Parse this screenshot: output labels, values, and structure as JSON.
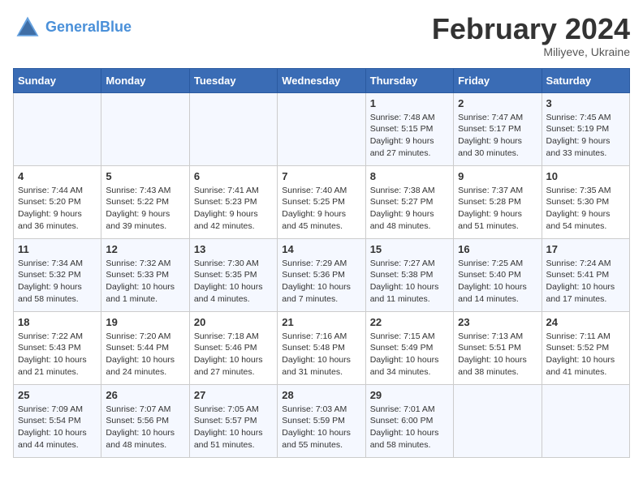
{
  "header": {
    "logo_line1": "General",
    "logo_line2": "Blue",
    "month_title": "February 2024",
    "subtitle": "Miliyeve, Ukraine"
  },
  "weekdays": [
    "Sunday",
    "Monday",
    "Tuesday",
    "Wednesday",
    "Thursday",
    "Friday",
    "Saturday"
  ],
  "weeks": [
    [
      {
        "day": "",
        "info": ""
      },
      {
        "day": "",
        "info": ""
      },
      {
        "day": "",
        "info": ""
      },
      {
        "day": "",
        "info": ""
      },
      {
        "day": "1",
        "info": "Sunrise: 7:48 AM\nSunset: 5:15 PM\nDaylight: 9 hours\nand 27 minutes."
      },
      {
        "day": "2",
        "info": "Sunrise: 7:47 AM\nSunset: 5:17 PM\nDaylight: 9 hours\nand 30 minutes."
      },
      {
        "day": "3",
        "info": "Sunrise: 7:45 AM\nSunset: 5:19 PM\nDaylight: 9 hours\nand 33 minutes."
      }
    ],
    [
      {
        "day": "4",
        "info": "Sunrise: 7:44 AM\nSunset: 5:20 PM\nDaylight: 9 hours\nand 36 minutes."
      },
      {
        "day": "5",
        "info": "Sunrise: 7:43 AM\nSunset: 5:22 PM\nDaylight: 9 hours\nand 39 minutes."
      },
      {
        "day": "6",
        "info": "Sunrise: 7:41 AM\nSunset: 5:23 PM\nDaylight: 9 hours\nand 42 minutes."
      },
      {
        "day": "7",
        "info": "Sunrise: 7:40 AM\nSunset: 5:25 PM\nDaylight: 9 hours\nand 45 minutes."
      },
      {
        "day": "8",
        "info": "Sunrise: 7:38 AM\nSunset: 5:27 PM\nDaylight: 9 hours\nand 48 minutes."
      },
      {
        "day": "9",
        "info": "Sunrise: 7:37 AM\nSunset: 5:28 PM\nDaylight: 9 hours\nand 51 minutes."
      },
      {
        "day": "10",
        "info": "Sunrise: 7:35 AM\nSunset: 5:30 PM\nDaylight: 9 hours\nand 54 minutes."
      }
    ],
    [
      {
        "day": "11",
        "info": "Sunrise: 7:34 AM\nSunset: 5:32 PM\nDaylight: 9 hours\nand 58 minutes."
      },
      {
        "day": "12",
        "info": "Sunrise: 7:32 AM\nSunset: 5:33 PM\nDaylight: 10 hours\nand 1 minute."
      },
      {
        "day": "13",
        "info": "Sunrise: 7:30 AM\nSunset: 5:35 PM\nDaylight: 10 hours\nand 4 minutes."
      },
      {
        "day": "14",
        "info": "Sunrise: 7:29 AM\nSunset: 5:36 PM\nDaylight: 10 hours\nand 7 minutes."
      },
      {
        "day": "15",
        "info": "Sunrise: 7:27 AM\nSunset: 5:38 PM\nDaylight: 10 hours\nand 11 minutes."
      },
      {
        "day": "16",
        "info": "Sunrise: 7:25 AM\nSunset: 5:40 PM\nDaylight: 10 hours\nand 14 minutes."
      },
      {
        "day": "17",
        "info": "Sunrise: 7:24 AM\nSunset: 5:41 PM\nDaylight: 10 hours\nand 17 minutes."
      }
    ],
    [
      {
        "day": "18",
        "info": "Sunrise: 7:22 AM\nSunset: 5:43 PM\nDaylight: 10 hours\nand 21 minutes."
      },
      {
        "day": "19",
        "info": "Sunrise: 7:20 AM\nSunset: 5:44 PM\nDaylight: 10 hours\nand 24 minutes."
      },
      {
        "day": "20",
        "info": "Sunrise: 7:18 AM\nSunset: 5:46 PM\nDaylight: 10 hours\nand 27 minutes."
      },
      {
        "day": "21",
        "info": "Sunrise: 7:16 AM\nSunset: 5:48 PM\nDaylight: 10 hours\nand 31 minutes."
      },
      {
        "day": "22",
        "info": "Sunrise: 7:15 AM\nSunset: 5:49 PM\nDaylight: 10 hours\nand 34 minutes."
      },
      {
        "day": "23",
        "info": "Sunrise: 7:13 AM\nSunset: 5:51 PM\nDaylight: 10 hours\nand 38 minutes."
      },
      {
        "day": "24",
        "info": "Sunrise: 7:11 AM\nSunset: 5:52 PM\nDaylight: 10 hours\nand 41 minutes."
      }
    ],
    [
      {
        "day": "25",
        "info": "Sunrise: 7:09 AM\nSunset: 5:54 PM\nDaylight: 10 hours\nand 44 minutes."
      },
      {
        "day": "26",
        "info": "Sunrise: 7:07 AM\nSunset: 5:56 PM\nDaylight: 10 hours\nand 48 minutes."
      },
      {
        "day": "27",
        "info": "Sunrise: 7:05 AM\nSunset: 5:57 PM\nDaylight: 10 hours\nand 51 minutes."
      },
      {
        "day": "28",
        "info": "Sunrise: 7:03 AM\nSunset: 5:59 PM\nDaylight: 10 hours\nand 55 minutes."
      },
      {
        "day": "29",
        "info": "Sunrise: 7:01 AM\nSunset: 6:00 PM\nDaylight: 10 hours\nand 58 minutes."
      },
      {
        "day": "",
        "info": ""
      },
      {
        "day": "",
        "info": ""
      }
    ]
  ]
}
